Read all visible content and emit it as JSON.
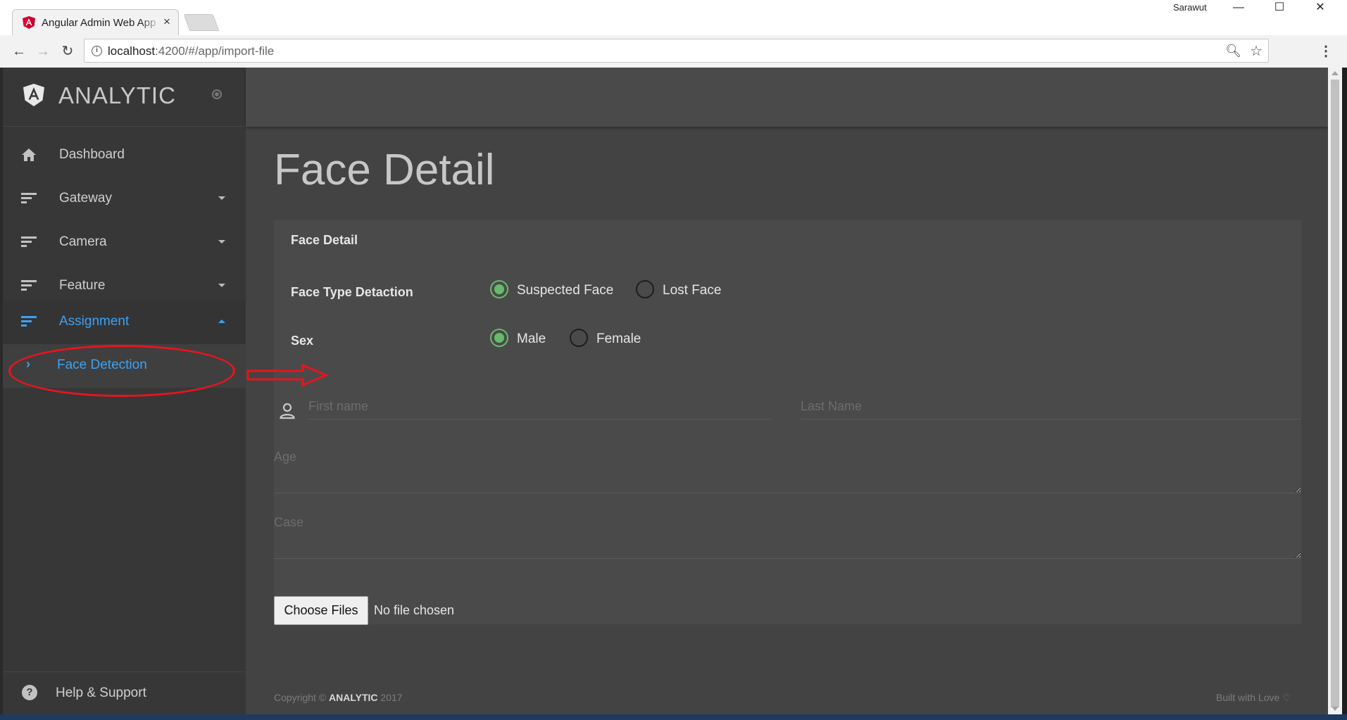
{
  "browser": {
    "tab_title": "Angular Admin Web App",
    "tab_close": "×",
    "user": "Sarawut",
    "window_minimize": "—",
    "window_maximize": "☐",
    "window_close": "✕",
    "url_host": "localhost",
    "url_path": ":4200/#/app/import-file",
    "back": "←",
    "forward": "→",
    "reload": "↻",
    "zoom_icon": "🔍︎",
    "star_icon": "☆",
    "menu_icon": "⋮"
  },
  "brand": {
    "name": "ANALYTIC"
  },
  "sidebar": {
    "items": [
      {
        "label": "Dashboard",
        "icon": "home-icon"
      },
      {
        "label": "Gateway",
        "icon": "sort-icon"
      },
      {
        "label": "Camera",
        "icon": "sort-icon"
      },
      {
        "label": "Feature",
        "icon": "sort-icon"
      },
      {
        "label": "Assignment",
        "icon": "sort-icon",
        "active": true
      }
    ],
    "subitem": {
      "label": "Face Detection",
      "chevron": "›"
    },
    "help": {
      "label": "Help & Support",
      "icon_glyph": "?"
    }
  },
  "page": {
    "title": "Face Detail"
  },
  "form": {
    "card_title": "Face Detail",
    "face_type": {
      "label": "Face Type Detaction",
      "options": [
        {
          "label": "Suspected Face",
          "checked": true
        },
        {
          "label": "Lost Face",
          "checked": false
        }
      ]
    },
    "sex": {
      "label": "Sex",
      "options": [
        {
          "label": "Male",
          "checked": true
        },
        {
          "label": "Female",
          "checked": false
        }
      ]
    },
    "first_name": {
      "placeholder": "First name",
      "value": ""
    },
    "last_name": {
      "placeholder": "Last Name",
      "value": ""
    },
    "age": {
      "placeholder": "Age",
      "value": ""
    },
    "case": {
      "placeholder": "Case",
      "value": ""
    },
    "file": {
      "button_label": "Choose Files",
      "status": "No file chosen"
    }
  },
  "footer": {
    "prefix": "Copyright © ",
    "brand": "ANALYTIC",
    "year": " 2017",
    "right": "Built with Love ♡"
  },
  "colors": {
    "accent": "#3ea1f3",
    "radio_checked": "#66bb6a",
    "annotation": "#e8141e",
    "sidebar_bg": "#373737",
    "content_bg": "#434343"
  }
}
